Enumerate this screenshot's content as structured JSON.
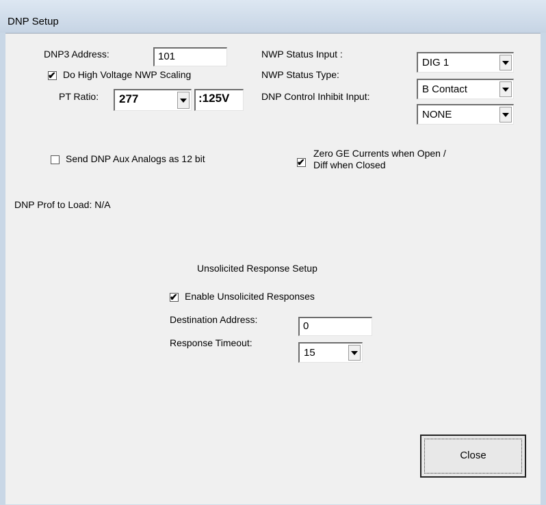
{
  "window": {
    "title": "DNP Setup"
  },
  "dnp3_address": {
    "label": "DNP3 Address:",
    "value": "101"
  },
  "nwp_status_input": {
    "label": "NWP Status Input :",
    "value": "DIG 1"
  },
  "high_voltage_scaling": {
    "label": "Do High Voltage NWP Scaling",
    "checked": true
  },
  "nwp_status_type": {
    "label": "NWP Status Type:",
    "value": "B Contact"
  },
  "pt_ratio": {
    "label": "PT Ratio:",
    "value": "277",
    "suffix": ":125V"
  },
  "control_inhibit": {
    "label": "DNP Control Inhibit Input:",
    "value": "NONE"
  },
  "aux_analogs": {
    "label": "Send DNP Aux Analogs as 12 bit",
    "checked": false
  },
  "zero_ge": {
    "label_line1": "Zero GE Currents when Open /",
    "label_line2": "Diff when Closed",
    "checked": true
  },
  "prof_to_load": {
    "text": "DNP Prof to Load: N/A"
  },
  "unsolicited": {
    "heading": "Unsolicited Response Setup",
    "enable": {
      "label": "Enable Unsolicited Responses",
      "checked": true
    },
    "destination": {
      "label": "Destination Address:",
      "value": "0"
    },
    "timeout": {
      "label": "Response Timeout:",
      "value": "15"
    }
  },
  "close_button": {
    "label": "Close"
  },
  "check_glyph": "✔"
}
